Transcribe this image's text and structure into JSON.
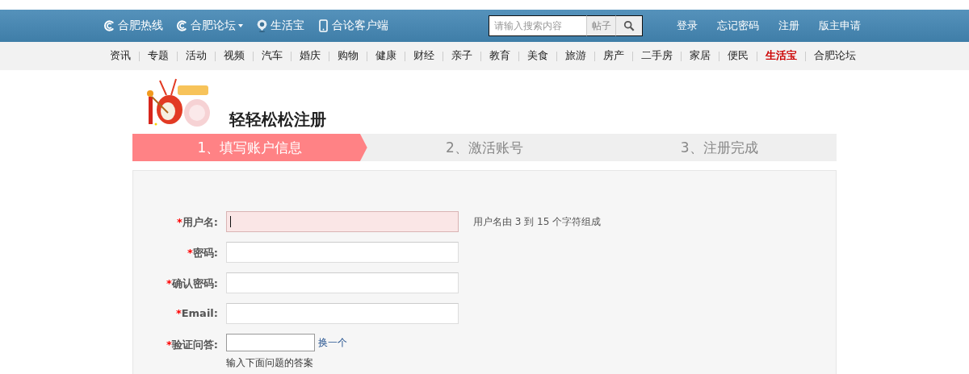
{
  "top_links": [
    {
      "kind": "c",
      "label": "合肥热线",
      "dropdown": false
    },
    {
      "kind": "c",
      "label": "合肥论坛",
      "dropdown": true
    },
    {
      "kind": "pin",
      "label": "生活宝",
      "dropdown": false
    },
    {
      "kind": "phone",
      "label": "合论客户端",
      "dropdown": false
    }
  ],
  "search": {
    "placeholder": "请输入搜索内容",
    "scope": "帖子"
  },
  "account_links": [
    "登录",
    "忘记密码",
    "注册",
    "版主申请"
  ],
  "nav": [
    {
      "label": "资讯",
      "highlighted": false
    },
    {
      "label": "专题",
      "highlighted": false
    },
    {
      "label": "活动",
      "highlighted": false
    },
    {
      "label": "视频",
      "highlighted": false
    },
    {
      "label": "汽车",
      "highlighted": false
    },
    {
      "label": "婚庆",
      "highlighted": false
    },
    {
      "label": "购物",
      "highlighted": false
    },
    {
      "label": "健康",
      "highlighted": false
    },
    {
      "label": "财经",
      "highlighted": false
    },
    {
      "label": "亲子",
      "highlighted": false
    },
    {
      "label": "教育",
      "highlighted": false
    },
    {
      "label": "美食",
      "highlighted": false
    },
    {
      "label": "旅游",
      "highlighted": false
    },
    {
      "label": "房产",
      "highlighted": false
    },
    {
      "label": "二手房",
      "highlighted": false
    },
    {
      "label": "家居",
      "highlighted": false
    },
    {
      "label": "便民",
      "highlighted": false
    },
    {
      "label": "生活宝",
      "highlighted": true
    },
    {
      "label": "合肥论坛",
      "highlighted": false
    }
  ],
  "page_title": "轻轻松松注册",
  "steps": [
    {
      "label": "1、填写账户信息",
      "selected": true
    },
    {
      "label": "2、激活账号",
      "selected": false
    },
    {
      "label": "3、注册完成",
      "selected": false
    }
  ],
  "form": {
    "fields": [
      {
        "kind": "wide",
        "required": "*",
        "label": "用户名:",
        "focused": true,
        "hint": "用户名由 3 到 15 个字符组成"
      },
      {
        "kind": "wide",
        "required": "*",
        "label": "密码:",
        "focused": false
      },
      {
        "kind": "wide",
        "required": "*",
        "label": "确认密码:",
        "focused": false
      },
      {
        "kind": "wide",
        "required": "*",
        "label": "Email:",
        "focused": false
      },
      {
        "kind": "captcha",
        "required": "*",
        "label": "验证问答:",
        "focused": false,
        "link": "换一个",
        "note": "输入下面问题的答案"
      }
    ]
  }
}
